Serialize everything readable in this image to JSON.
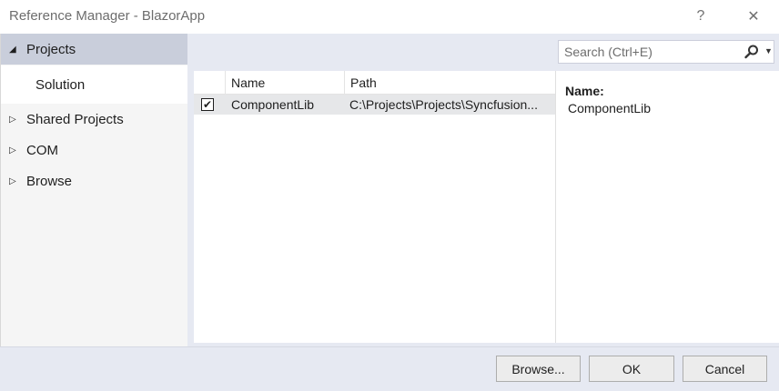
{
  "window": {
    "title": "Reference Manager - BlazorApp",
    "help_glyph": "?",
    "close_glyph": "✕"
  },
  "sidebar": {
    "items": [
      {
        "label": "Projects",
        "arrow": "◢",
        "state": "expanded"
      },
      {
        "label": "Solution",
        "arrow": "",
        "state": "selected"
      },
      {
        "label": "Shared Projects",
        "arrow": "▷",
        "state": "collapsed"
      },
      {
        "label": "COM",
        "arrow": "▷",
        "state": "collapsed"
      },
      {
        "label": "Browse",
        "arrow": "▷",
        "state": "collapsed"
      }
    ]
  },
  "search": {
    "placeholder": "Search (Ctrl+E)",
    "value": "",
    "icon": "search-icon",
    "dropdown_glyph": "▼"
  },
  "grid": {
    "columns": [
      "",
      "Name",
      "Path"
    ],
    "rows": [
      {
        "checked": true,
        "check_glyph": "✔",
        "name": "ComponentLib",
        "path": "C:\\Projects\\Projects\\Syncfusion..."
      }
    ]
  },
  "details": {
    "label": "Name:",
    "value": "ComponentLib"
  },
  "footer": {
    "browse_label": "Browse...",
    "ok_label": "OK",
    "cancel_label": "Cancel"
  },
  "colors": {
    "sidebar_selected_header": "#c9cedb",
    "panel_background": "#e6e9f2",
    "row_selected": "#e6e7e9"
  }
}
